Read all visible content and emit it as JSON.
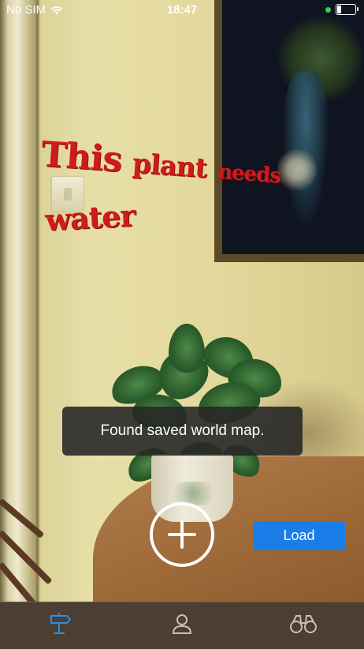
{
  "status_bar": {
    "carrier": "No SIM",
    "time": "18:47"
  },
  "ar_label": {
    "line1_a": "This",
    "line1_b": "plant",
    "line1_c": "needs",
    "line2": "water"
  },
  "toast": {
    "message": "Found saved world map."
  },
  "actions": {
    "load_label": "Load"
  },
  "tabs": [
    {
      "icon": "signpost-icon",
      "active": true
    },
    {
      "icon": "person-icon",
      "active": false
    },
    {
      "icon": "binoculars-icon",
      "active": false
    }
  ],
  "colors": {
    "accent": "#1a7ee8",
    "ar_text": "#d01b1b",
    "tab_active": "#2a8ef0",
    "tab_inactive": "#c9bfb3"
  }
}
